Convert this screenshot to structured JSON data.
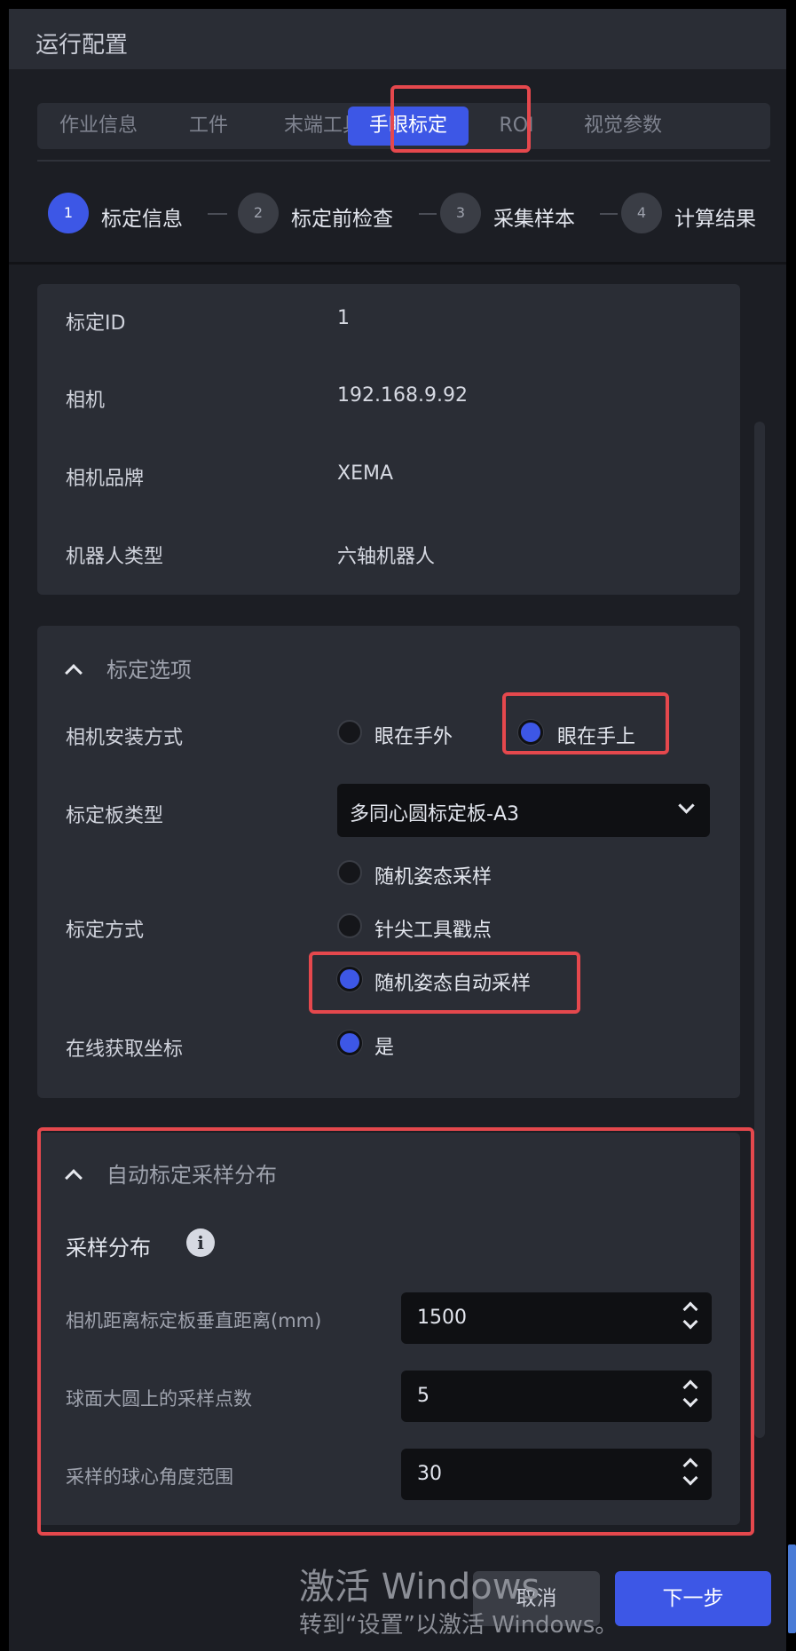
{
  "window": {
    "title": "运行配置"
  },
  "tabs": [
    {
      "label": "作业信息",
      "active": false
    },
    {
      "label": "工件",
      "active": false
    },
    {
      "label": "末端工具",
      "active": false
    },
    {
      "label": "手眼标定",
      "active": true
    },
    {
      "label": "ROI",
      "active": false
    },
    {
      "label": "视觉参数",
      "active": false
    }
  ],
  "steps": [
    {
      "number": "1",
      "label": "标定信息",
      "active": true
    },
    {
      "number": "2",
      "label": "标定前检查",
      "active": false
    },
    {
      "number": "3",
      "label": "采集样本",
      "active": false
    },
    {
      "number": "4",
      "label": "计算结果",
      "active": false
    }
  ],
  "info": {
    "rows": [
      {
        "label": "标定ID",
        "value": "1"
      },
      {
        "label": "相机",
        "value": "192.168.9.92"
      },
      {
        "label": "相机品牌",
        "value": "XEMA"
      },
      {
        "label": "机器人类型",
        "value": "六轴机器人"
      }
    ]
  },
  "options": {
    "title": "标定选项",
    "mount": {
      "label": "相机安装方式",
      "choices": [
        {
          "label": "眼在手外",
          "checked": false
        },
        {
          "label": "眼在手上",
          "checked": true
        }
      ]
    },
    "board": {
      "label": "标定板类型",
      "value": "多同心圆标定板-A3"
    },
    "method": {
      "label": "标定方式",
      "choices": [
        {
          "label": "随机姿态采样",
          "checked": false
        },
        {
          "label": "针尖工具戳点",
          "checked": false
        },
        {
          "label": "随机姿态自动采样",
          "checked": true
        }
      ]
    },
    "online": {
      "label": "在线获取坐标",
      "choice": "是",
      "checked": true
    }
  },
  "auto": {
    "title": "自动标定采样分布",
    "subtitle": "采样分布",
    "info_symbol": "i",
    "fields": [
      {
        "label": "相机距离标定板垂直距离(mm)",
        "value": "1500"
      },
      {
        "label": "球面大圆上的采样点数",
        "value": "5"
      },
      {
        "label": "采样的球心角度范围",
        "value": "30"
      }
    ]
  },
  "footer": {
    "cancel": "取消",
    "next": "下一步"
  },
  "watermark": {
    "line1": "激活 Windows",
    "line2": "转到“设置”以激活 Windows。"
  },
  "colors": {
    "accent": "#3d57e6",
    "highlight": "#e5484d",
    "panel": "#2a2d35",
    "background": "#1c1e24"
  },
  "icons": [
    "chevron-up-icon",
    "chevron-down-icon",
    "info-icon",
    "spinner-up-icon",
    "spinner-down-icon"
  ]
}
